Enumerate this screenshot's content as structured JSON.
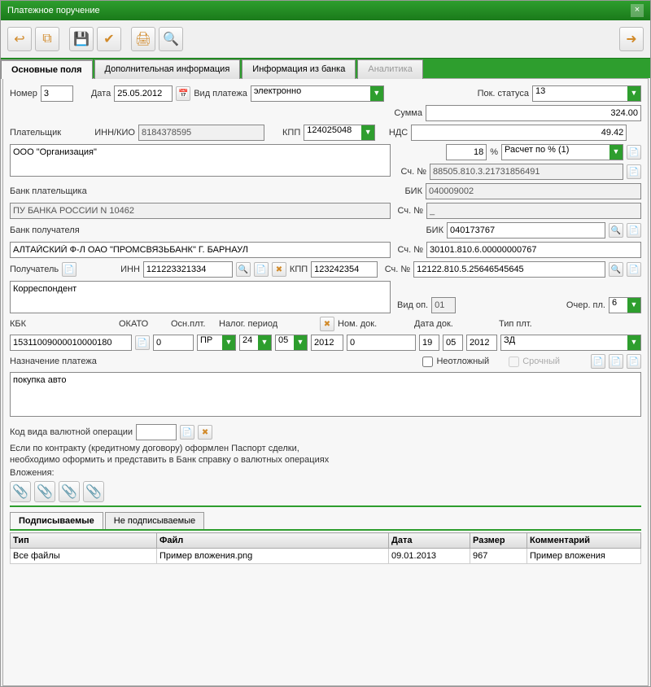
{
  "window": {
    "title": "Платежное поручение"
  },
  "tabs": {
    "main": "Основные поля",
    "extra": "Дополнительная информация",
    "bank": "Информация из банка",
    "analytics": "Аналитика"
  },
  "header": {
    "number_lbl": "Номер",
    "number": "3",
    "date_lbl": "Дата",
    "date": "25.05.2012",
    "paytype_lbl": "Вид платежа",
    "paytype": "электронно",
    "status_lbl": "Пок. статуса",
    "status": "13"
  },
  "sum": {
    "sum_lbl": "Сумма",
    "sum": "324.00",
    "nds_lbl": "НДС",
    "nds": "49.42",
    "pct": "18",
    "pct_sym": "%",
    "calc": "Расчет по % (1)"
  },
  "payer": {
    "lbl": "Плательщик",
    "inn_lbl": "ИНН/КИО",
    "inn": "8184378595",
    "kpp_lbl": "КПП",
    "kpp": "124025048",
    "name": "ООО \"Организация\"",
    "acc_lbl": "Сч. №",
    "acc": "88505.810.3.21731856491",
    "bank_lbl": "Банк плательщика",
    "bik_lbl": "БИК",
    "bik": "040009002",
    "bank_name": "ПУ БАНКА РОССИИ N 10462",
    "bank_acc_lbl": "Сч. №",
    "bank_acc": "_"
  },
  "recipient": {
    "bank_lbl": "Банк получателя",
    "bik_lbl": "БИК",
    "bik": "040173767",
    "bank_name": "АЛТАЙСКИЙ Ф-Л ОАО \"ПРОМСВЯЗЬБАНК\" Г. БАРНАУЛ",
    "bank_acc_lbl": "Сч. №",
    "bank_acc": "30101.810.6.00000000767",
    "lbl": "Получатель",
    "inn_lbl": "ИНН",
    "inn": "121223321334",
    "kpp_lbl": "КПП",
    "kpp": "123242354",
    "acc_lbl": "Сч. №",
    "acc": "12122.810.5.25646545645",
    "name": "Корреспондент",
    "vidop_lbl": "Вид оп.",
    "vidop": "01",
    "ocher_lbl": "Очер. пл.",
    "ocher": "6"
  },
  "budget": {
    "kbk_lbl": "КБК",
    "okato_lbl": "ОКАТО",
    "osn_lbl": "Осн.плт.",
    "period_lbl": "Налог. период",
    "nomdoc_lbl": "Ном. док.",
    "datadoc_lbl": "Дата док.",
    "tip_lbl": "Тип плт.",
    "kbk": "15311009000010000180",
    "okato": "0",
    "osn": "ПР",
    "p1": "24",
    "p2": "05",
    "p3": "2012",
    "nomdoc": "0",
    "d1": "19",
    "d2": "05",
    "d3": "2012",
    "tip": "ЗД"
  },
  "purpose": {
    "lbl": "Назначение платежа",
    "urgent_lbl": "Неотложный",
    "term_lbl": "Срочный",
    "text": "покупка авто",
    "code_lbl": "Код вида валютной операции",
    "note1": "Если по контракту (кредитному договору) оформлен Паспорт сделки,",
    "note2": "необходимо оформить и представить в Банк справку о валютных операциях",
    "attach_lbl": "Вложения:"
  },
  "subtabs": {
    "signed": "Подписываемые",
    "unsigned": "Не подписываемые"
  },
  "table": {
    "h_type": "Тип",
    "h_file": "Файл",
    "h_date": "Дата",
    "h_size": "Размер",
    "h_comment": "Комментарий",
    "r_type": "Все файлы",
    "r_file": "Пример вложения.png",
    "r_date": "09.01.2013",
    "r_size": "967",
    "r_comment": "Пример вложения"
  }
}
